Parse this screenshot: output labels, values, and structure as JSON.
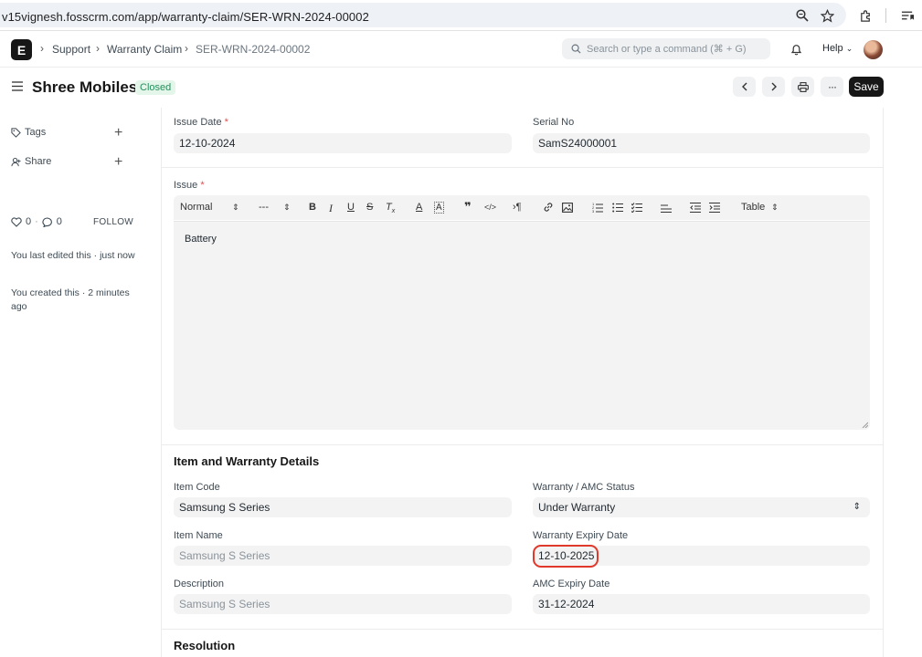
{
  "browser": {
    "url": "v15vignesh.fosscrm.com/app/warranty-claim/SER-WRN-2024-00002"
  },
  "navbar": {
    "logo_letter": "E",
    "breadcrumbs": [
      "Support",
      "Warranty Claim",
      "SER-WRN-2024-00002"
    ],
    "search_placeholder": "Search or type a command (⌘ + G)",
    "help_label": "Help"
  },
  "header": {
    "title": "Shree Mobiles",
    "status": "Closed",
    "save_label": "Save"
  },
  "sidebar": {
    "tags_label": "Tags",
    "share_label": "Share",
    "likes_count": "0",
    "comments_count": "0",
    "follow_label": "FOLLOW",
    "last_edited": "You last edited this · just now",
    "created": "You created this · 2 minutes ago"
  },
  "form": {
    "issue_date": {
      "label": "Issue Date",
      "value": "12-10-2024"
    },
    "serial_no": {
      "label": "Serial No",
      "value": "SamS24000001"
    },
    "issue": {
      "label": "Issue",
      "text": "Battery",
      "toolbar": {
        "style_select": "Normal",
        "size_select": "---",
        "table_select": "Table"
      }
    },
    "item_section_title": "Item and Warranty Details",
    "item_code": {
      "label": "Item Code",
      "value": "Samsung S Series"
    },
    "warranty_status": {
      "label": "Warranty / AMC Status",
      "value": "Under Warranty"
    },
    "item_name": {
      "label": "Item Name",
      "value": "Samsung S Series"
    },
    "warranty_expiry": {
      "label": "Warranty Expiry Date",
      "value": "12-10-2025"
    },
    "description": {
      "label": "Description",
      "value": "Samsung S Series"
    },
    "amc_expiry": {
      "label": "AMC Expiry Date",
      "value": "31-12-2024"
    },
    "resolution_title": "Resolution"
  },
  "colors": {
    "accent": "#171717",
    "status_bg": "#e4f5e9",
    "status_fg": "#278f5e",
    "highlight": "#e0392b"
  }
}
